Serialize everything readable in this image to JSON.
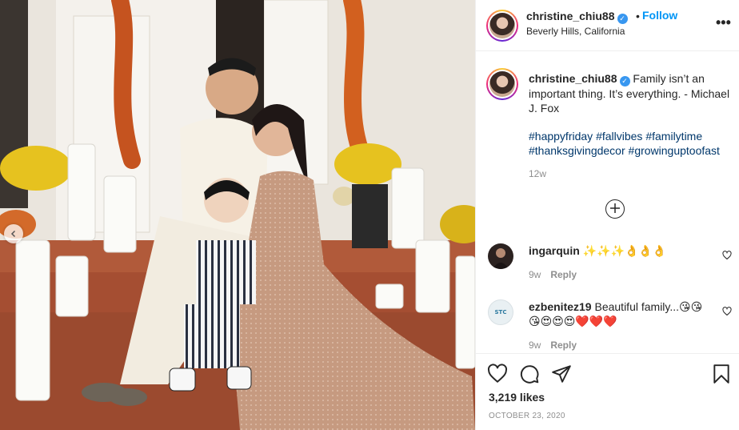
{
  "photo": {
    "alt": "Family photo",
    "icons": {
      "carousel_prev": "chevron-left-icon"
    }
  },
  "header": {
    "username": "christine_chiu88",
    "verified_icon": "verified-badge-icon",
    "separator": "•",
    "follow_label": "Follow",
    "location": "Beverly Hills, California",
    "more_label": "•••"
  },
  "caption": {
    "username": "christine_chiu88",
    "text": "Family isn’t an important thing. It’s everything. - Michael J. Fox",
    "hashtags": [
      "#happyfriday",
      "#fallvibes",
      "#familytime",
      "#thanksgivingdecor",
      "#growinguptoofast"
    ],
    "time": "12w"
  },
  "load_more_icon": "plus-circle-icon",
  "comments": [
    {
      "username": "ingarquin",
      "text": "✨✨✨👌👌👌",
      "time": "9w",
      "reply_label": "Reply"
    },
    {
      "username": "ezbenitez19",
      "text": "Beautiful family...😘😘😘😍😍😍❤️❤️❤️",
      "time": "9w",
      "reply_label": "Reply",
      "avatar_text": "STC"
    }
  ],
  "actions": {
    "icons": [
      "heart-icon",
      "comment-icon",
      "share-icon",
      "bookmark-icon"
    ],
    "likes": "3,219 likes",
    "date": "OCTOBER 23, 2020"
  },
  "colors": {
    "link_blue": "#0095f6",
    "hashtag_blue": "#00376b",
    "muted": "#8e8e8e",
    "text": "#262626",
    "border": "#efefef"
  }
}
